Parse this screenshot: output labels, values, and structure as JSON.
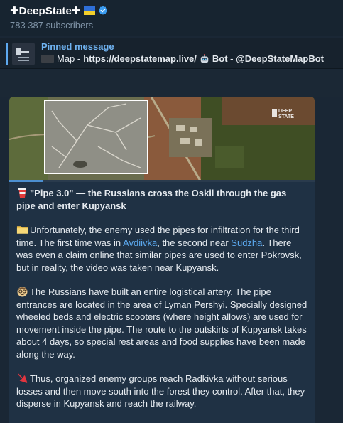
{
  "header": {
    "title": "✚DeepState✚",
    "subscribers": "783 387 subscribers"
  },
  "pinned": {
    "label": "Pinned message",
    "map_text": "Map - ",
    "map_url": "https://deepstatemap.live/",
    "bot_text": "Bot - @DeepStateMapBot"
  },
  "media": {
    "watermark": "DEEP STATE",
    "progress": 0.11
  },
  "message": {
    "title": "\"Pipe 3.0\" — the Russians cross the Oskil through the gas pipe and enter Kupyansk",
    "p1_a": "Unfortunately, the enemy used the pipes for infiltration for the third time. The first time was in ",
    "p1_link1": "Avdiivka",
    "p1_b": ", the second near ",
    "p1_link2": "Sudzha",
    "p1_c": ". There was even a claim online that similar pipes are used to enter Pokrovsk, but in reality, the video was taken near Kupyansk.",
    "p2": "The Russians have built an entire logistical artery. The pipe entrances are located in the area of Lyman Pershyi. Specially designed wheeled beds and electric scooters (where height allows) are used for movement inside the pipe. The route to the outskirts of Kupyansk takes about 4 days, so special rest areas and food supplies have been made along the way.",
    "p3": "Thus, organized enemy groups reach Radkivka without serious losses and then move south into the forest they control. After that, they disperse in Kupyansk and reach the railway."
  },
  "icons": {
    "verified": "verified-badge-icon",
    "flag": "ukraine-flag-icon",
    "pin_flag": "black-flag-icon",
    "robot": "robot-icon",
    "cup": "red-cup-icon",
    "folder": "folder-icon",
    "face": "nerd-face-icon",
    "arrow": "red-arrow-icon"
  },
  "colors": {
    "accent": "#5ba8ee",
    "bubble": "#1f3144",
    "background": "#1a2735"
  }
}
